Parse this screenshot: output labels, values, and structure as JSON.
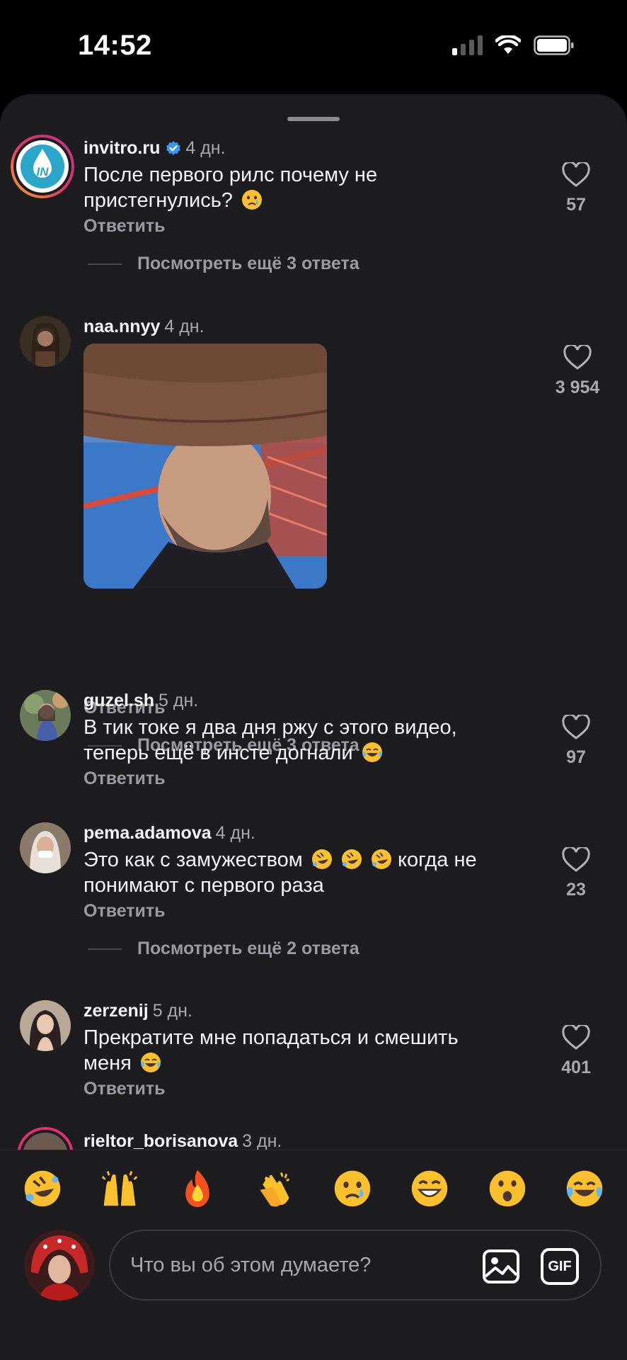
{
  "status_bar": {
    "time": "14:52"
  },
  "comments": [
    {
      "username": "invitro.ru",
      "time": "4 дн.",
      "verified": true,
      "text_line1": "После первого рилс почему не",
      "text_line2": "пристегнулись?",
      "text_emoji": "crying-face",
      "reply_label": "Ответить",
      "likes": "57",
      "more_replies": "Посмотреть ещё 3 ответа"
    },
    {
      "username": "naa.nnyy",
      "time": "4 дн.",
      "reply_label": "Ответить",
      "likes": "3 954",
      "more_replies": "Посмотреть ещё 3 ответа"
    },
    {
      "username": "guzel.sh",
      "time": "5 дн.",
      "text_line1": "В тик токе я два дня ржу с этого видео,",
      "text_line2": "теперь ещё в инсте догнали",
      "text_emoji": "tears-of-joy",
      "reply_label": "Ответить",
      "likes": "97"
    },
    {
      "username": "pema.adamova",
      "time": "4 дн.",
      "text_line1_a": "Это как с замужеством",
      "text_line1_b": "когда не",
      "text_line2": "понимают с первого раза",
      "reply_label": "Ответить",
      "likes": "23",
      "more_replies": "Посмотреть ещё 2 ответа"
    },
    {
      "username": "zerzenij",
      "time": "5 дн.",
      "text_line1": "Прекратите мне попадаться и смешить",
      "text_line2": "меня",
      "text_emoji": "tears-of-joy",
      "reply_label": "Ответить",
      "likes": "401"
    },
    {
      "username": "rieltor_borisanova",
      "time": "3 дн."
    }
  ],
  "reactions": [
    "rolling-on-floor-laughing",
    "raising-hands",
    "fire",
    "clapping-hands",
    "crying-face",
    "grinning-face",
    "astonished-face",
    "tears-of-joy"
  ],
  "composer": {
    "placeholder": "Что вы об этом думаете?",
    "gif_label": "GIF"
  },
  "colors": {
    "background": "#1c1c1e",
    "text": "#f5f5f5",
    "muted": "#a8a8ad",
    "verified": "#3897f0"
  }
}
